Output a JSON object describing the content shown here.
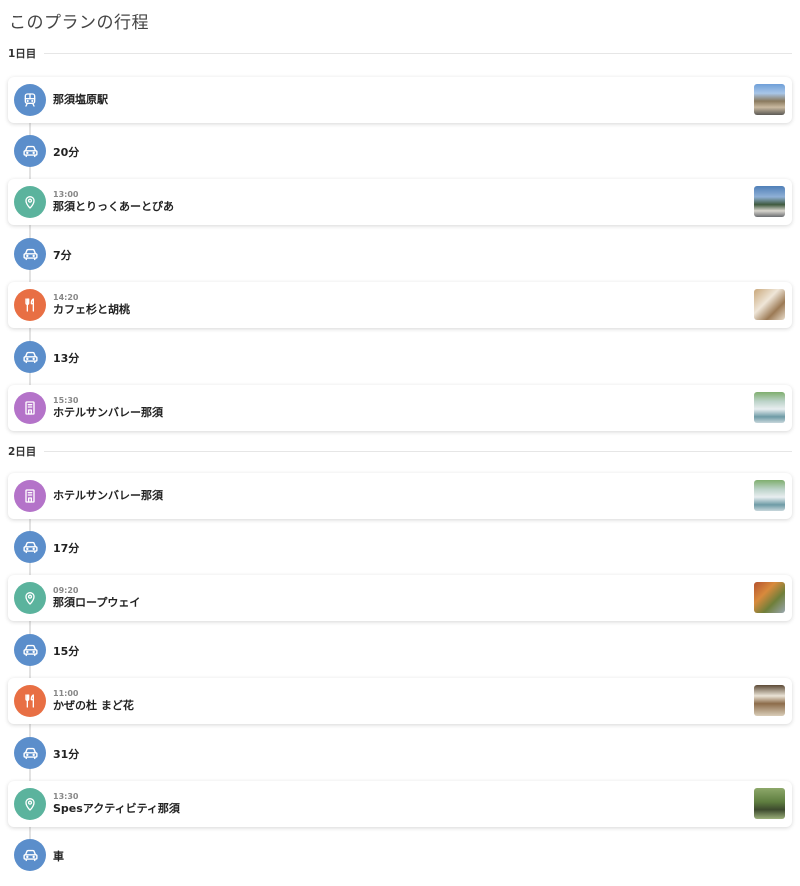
{
  "page_title": "このプランの行程",
  "days": [
    {
      "label": "1日目"
    },
    {
      "label": "2日目"
    }
  ],
  "stops": [
    {
      "time": "",
      "name": "那須塩原駅",
      "icon": "train-icon",
      "category": "station"
    },
    {
      "time": "13:00",
      "name": "那須とりっくあーとぴあ",
      "icon": "map-pin-icon",
      "category": "spot"
    },
    {
      "time": "14:20",
      "name": "カフェ杉と胡桃",
      "icon": "restaurant-icon",
      "category": "restaurant"
    },
    {
      "time": "15:30",
      "name": "ホテルサンバレー那須",
      "icon": "hotel-icon",
      "category": "hotel"
    },
    {
      "time": "",
      "name": "ホテルサンバレー那須",
      "icon": "hotel-icon",
      "category": "hotel"
    },
    {
      "time": "09:20",
      "name": "那須ロープウェイ",
      "icon": "map-pin-icon",
      "category": "spot"
    },
    {
      "time": "11:00",
      "name": "かぜの杜 まど花",
      "icon": "restaurant-icon",
      "category": "restaurant"
    },
    {
      "time": "13:30",
      "name": "Spesアクティビティ那須",
      "icon": "map-pin-icon",
      "category": "spot"
    }
  ],
  "moves": [
    {
      "label": "20分",
      "icon": "car-icon"
    },
    {
      "label": "7分",
      "icon": "car-icon"
    },
    {
      "label": "13分",
      "icon": "car-icon"
    },
    {
      "label": "17分",
      "icon": "car-icon"
    },
    {
      "label": "15分",
      "icon": "car-icon"
    },
    {
      "label": "31分",
      "icon": "car-icon"
    },
    {
      "label": "車",
      "icon": "car-icon"
    }
  ],
  "colors": {
    "move": "#5b8ecb",
    "station": "#5b8ecb",
    "spot": "#5bb39d",
    "restaurant": "#e86f44",
    "hotel": "#b473c9"
  }
}
